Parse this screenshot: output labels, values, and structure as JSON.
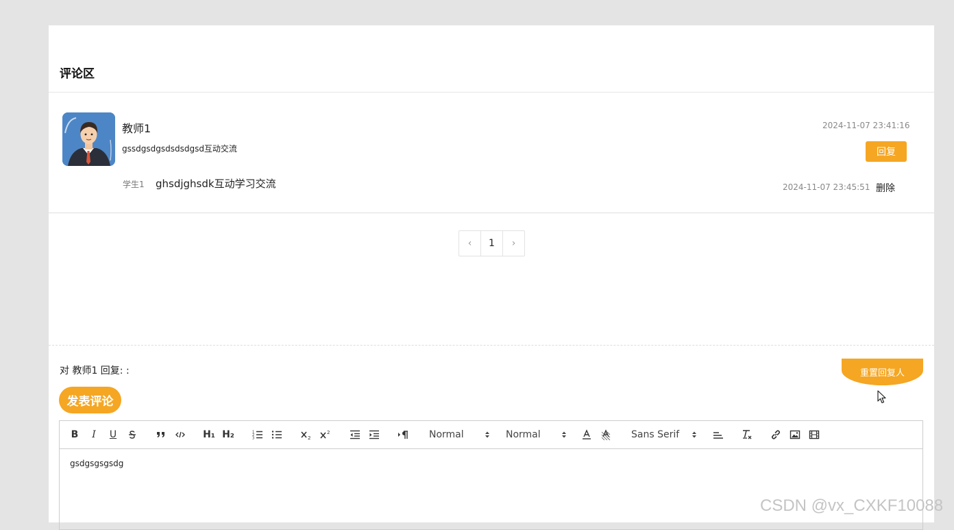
{
  "comments": {
    "section_title": "评论区",
    "items": [
      {
        "author": "教师1",
        "text": "gssdgsdgsdsdsdgsd互动交流",
        "time": "2024-11-07 23:41:16",
        "reply_label": "回复",
        "replies": [
          {
            "user": "学生1",
            "text": "ghsdjghsdk互动学习交流",
            "time": "2024-11-07 23:45:51",
            "delete_label": "删除"
          }
        ]
      }
    ]
  },
  "pagination": {
    "prev": "‹",
    "current_page": "1",
    "next": "›"
  },
  "reply_form": {
    "target_text": "对 教师1 回复: :",
    "reset_label": "重置回复人",
    "post_label": "发表评论"
  },
  "editor": {
    "toolbar": {
      "bold": "B",
      "italic": "I",
      "underline": "U",
      "h1": "H₁",
      "h2": "H₂",
      "size_select": "Normal",
      "header_select": "Normal",
      "font_select": "Sans Serif"
    },
    "content": "gsdgsgsgsdg"
  },
  "watermark": "CSDN @vx_CXKF10088",
  "colors": {
    "accent": "#f5a623",
    "background": "#e4e4e4",
    "panel": "#ffffff"
  }
}
